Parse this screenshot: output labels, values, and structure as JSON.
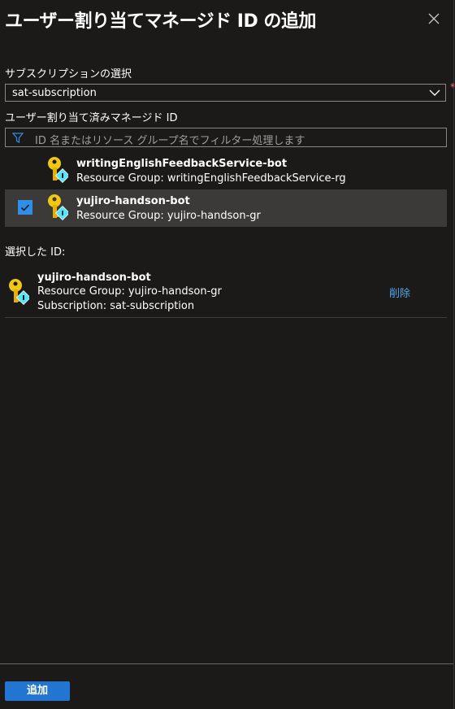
{
  "panel": {
    "title": "ユーザー割り当てマネージド ID の追加",
    "close_icon": "close-icon"
  },
  "subscription": {
    "label": "サブスクリプションの選択",
    "value": "sat-subscription",
    "required_marker": "*"
  },
  "identities": {
    "label": "ユーザー割り当て済みマネージド ID",
    "filter_placeholder": "ID 名またはリソース グループ名でフィルター処理します",
    "items": [
      {
        "name": "writingEnglishFeedbackService-bot",
        "resource_group": "Resource Group: writingEnglishFeedbackService-rg",
        "selected": false
      },
      {
        "name": "yujiro-handson-bot",
        "resource_group": "Resource Group: yujiro-handson-gr",
        "selected": true
      }
    ]
  },
  "selected_ids": {
    "label": "選択した ID:",
    "items": [
      {
        "name": "yujiro-handson-bot",
        "resource_group": "Resource Group: yujiro-handson-gr",
        "subscription": "Subscription: sat-subscription",
        "remove_label": "削除"
      }
    ]
  },
  "footer": {
    "add_label": "追加"
  },
  "colors": {
    "background": "#1b1a19",
    "accent": "#2275d1",
    "link": "#4ea8ec",
    "key_icon": "#f2c811"
  }
}
